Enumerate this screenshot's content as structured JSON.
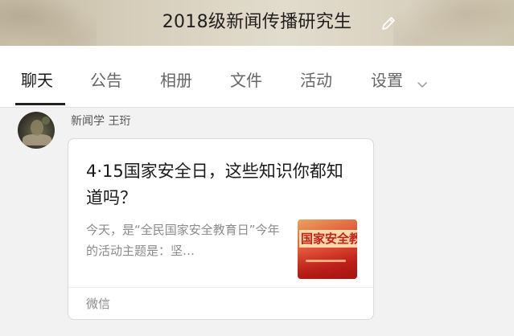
{
  "header": {
    "title": "2018级新闻传播研究生",
    "edit_icon": "pencil-icon"
  },
  "tabs": [
    {
      "label": "聊天",
      "active": true
    },
    {
      "label": "公告",
      "active": false
    },
    {
      "label": "相册",
      "active": false
    },
    {
      "label": "文件",
      "active": false
    },
    {
      "label": "活动",
      "active": false
    },
    {
      "label": "设置",
      "active": false,
      "icon": "chevron-down-icon"
    }
  ],
  "message": {
    "sender": "新闻学 王珩",
    "card": {
      "title": "4·15国家安全日，这些知识你都知道吗？",
      "description": "今天，是“全民国家安全教育日”今年的活动主题是：坚…",
      "thumbnail_text": "国家安全教",
      "source": "微信"
    }
  },
  "colors": {
    "header_bg": "#d8d0bd",
    "tab_active": "#1a1a1a",
    "tab_inactive": "#666666",
    "chat_bg": "#f2f2f2",
    "thumbnail_red": "#c9261d"
  }
}
